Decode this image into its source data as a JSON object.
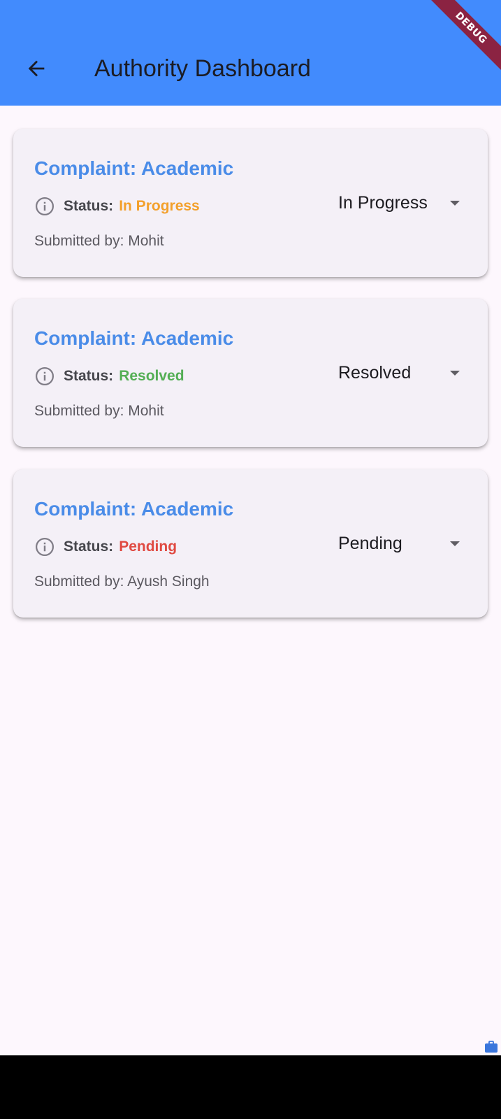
{
  "app_bar": {
    "title": "Authority Dashboard",
    "background": "#428bfd",
    "back_icon": "arrow-back-icon"
  },
  "debug_banner": {
    "label": "DEBUG",
    "color": "#8b2342"
  },
  "complaints": [
    {
      "title": "Complaint: Academic",
      "status_label": "Status:",
      "status_value": "In Progress",
      "status_color": "#f3a02b",
      "dropdown_value": "In Progress",
      "submitted_by": "Submitted by: Mohit"
    },
    {
      "title": "Complaint: Academic",
      "status_label": "Status:",
      "status_value": "Resolved",
      "status_color": "#54ae55",
      "dropdown_value": "Resolved",
      "submitted_by": "Submitted by: Mohit"
    },
    {
      "title": "Complaint: Academic",
      "status_label": "Status:",
      "status_value": "Pending",
      "status_color": "#e04a42",
      "dropdown_value": "Pending",
      "submitted_by": "Submitted by: Ayush Singh"
    }
  ],
  "icons": {
    "info": "info-icon",
    "dropdown": "arrow-drop-down-icon",
    "corner": "briefcase-icon"
  },
  "colors": {
    "title_text": "#4a8ce8",
    "card_background": "#f4f0f7",
    "page_background": "#fdf7fd"
  }
}
